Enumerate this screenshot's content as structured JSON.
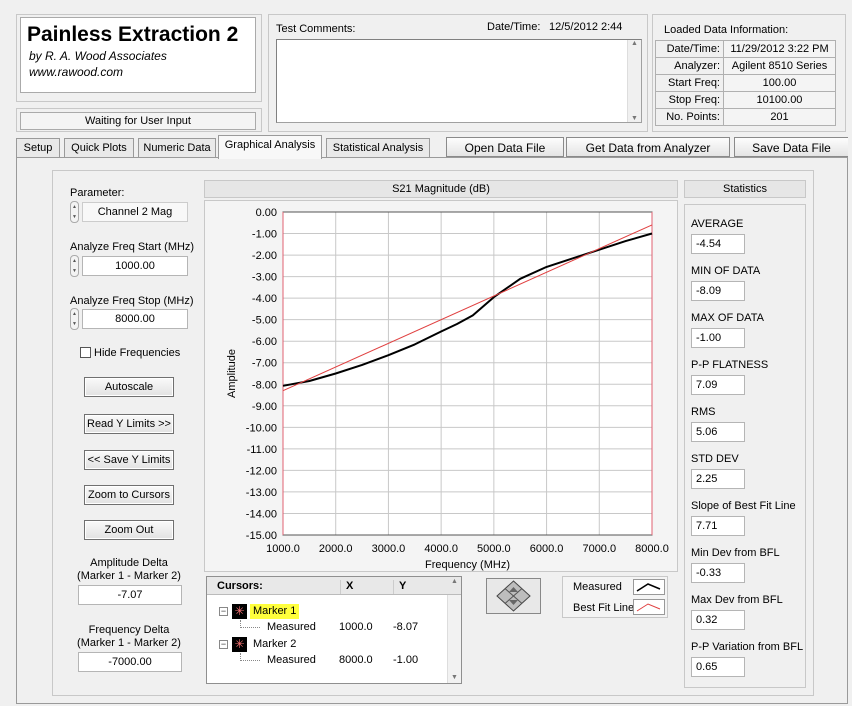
{
  "app": {
    "title": "Painless Extraction 2",
    "byline": "by R. A. Wood Associates",
    "url": "www.rawood.com",
    "status": "Waiting for User Input"
  },
  "comments": {
    "label": "Test Comments:"
  },
  "datetime": {
    "label": "Date/Time:",
    "value": "12/5/2012  2:44"
  },
  "loaded": {
    "title": "Loaded Data Information:",
    "rows": [
      {
        "key": "Date/Time:",
        "value": "11/29/2012 3:22 PM"
      },
      {
        "key": "Analyzer:",
        "value": "Agilent 8510 Series"
      },
      {
        "key": "Start Freq:",
        "value": "100.00"
      },
      {
        "key": "Stop Freq:",
        "value": "10100.00"
      },
      {
        "key": "No. Points:",
        "value": "201"
      }
    ]
  },
  "tabs": [
    "Setup",
    "Quick Plots",
    "Numeric Data",
    "Graphical Analysis",
    "Statistical Analysis"
  ],
  "actions": {
    "open": "Open Data File",
    "get": "Get Data from Analyzer",
    "save": "Save Data File"
  },
  "left": {
    "parameter_label": "Parameter:",
    "parameter_value": "Channel 2 Mag",
    "start_label": "Analyze Freq Start (MHz)",
    "start_value": "1000.00",
    "stop_label": "Analyze Freq Stop (MHz)",
    "stop_value": "8000.00",
    "hide_freq": "Hide Frequencies",
    "buttons": [
      "Autoscale",
      "Read Y Limits >>",
      "<< Save Y Limits",
      "Zoom to Cursors",
      "Zoom Out"
    ],
    "amp_delta_label1": "Amplitude Delta",
    "amp_delta_label2": "(Marker 1 - Marker 2)",
    "amp_delta_value": "-7.07",
    "freq_delta_label1": "Frequency Delta",
    "freq_delta_label2": "(Marker 1 - Marker 2)",
    "freq_delta_value": "-7000.00"
  },
  "chart_data": {
    "type": "line",
    "title": "S21 Magnitude (dB)",
    "xlabel": "Frequency (MHz)",
    "ylabel": "Amplitude",
    "xlim": [
      1000,
      8000
    ],
    "ylim": [
      -15,
      0
    ],
    "x_ticks": [
      "1000.0",
      "2000.0",
      "3000.0",
      "4000.0",
      "5000.0",
      "6000.0",
      "7000.0",
      "8000.0"
    ],
    "y_ticks": [
      "0.00",
      "-1.00",
      "-2.00",
      "-3.00",
      "-4.00",
      "-5.00",
      "-6.00",
      "-7.00",
      "-8.00",
      "-9.00",
      "-10.00",
      "-11.00",
      "-12.00",
      "-13.00",
      "-14.00",
      "-15.00"
    ],
    "grid": true,
    "series": [
      {
        "name": "Measured",
        "color": "#000000",
        "x": [
          1000,
          1500,
          2000,
          2500,
          3000,
          3500,
          4000,
          4300,
          4600,
          5000,
          5500,
          6000,
          6500,
          7000,
          7500,
          8000
        ],
        "y": [
          -8.07,
          -7.85,
          -7.5,
          -7.1,
          -6.65,
          -6.15,
          -5.55,
          -5.2,
          -4.8,
          -3.95,
          -3.1,
          -2.55,
          -2.15,
          -1.75,
          -1.35,
          -1.0
        ]
      },
      {
        "name": "Best Fit Line",
        "color": "#e04040",
        "x": [
          1000,
          8000
        ],
        "y": [
          -8.3,
          -0.6
        ]
      }
    ],
    "cursor_color": "#e06070"
  },
  "cursors": {
    "header": [
      "Cursors:",
      "X",
      "Y"
    ],
    "markers": [
      {
        "name": "Marker 1",
        "sub": "Measured",
        "x": "1000.0",
        "y": "-8.07"
      },
      {
        "name": "Marker 2",
        "sub": "Measured",
        "x": "8000.0",
        "y": "-1.00"
      }
    ]
  },
  "legend": {
    "measured": "Measured",
    "bestfit": "Best Fit Line"
  },
  "stats": {
    "title": "Statistics",
    "items": [
      {
        "label": "AVERAGE",
        "value": "-4.54"
      },
      {
        "label": "MIN OF DATA",
        "value": "-8.09"
      },
      {
        "label": "MAX OF DATA",
        "value": "-1.00"
      },
      {
        "label": "P-P FLATNESS",
        "value": "7.09"
      },
      {
        "label": "RMS",
        "value": "5.06"
      },
      {
        "label": "STD DEV",
        "value": "2.25"
      },
      {
        "label": "Slope of Best Fit Line",
        "value": "7.71"
      },
      {
        "label": "Min Dev from BFL",
        "value": "-0.33"
      },
      {
        "label": "Max Dev from BFL",
        "value": "0.32"
      },
      {
        "label": "P-P Variation from BFL",
        "value": "0.65"
      }
    ]
  }
}
